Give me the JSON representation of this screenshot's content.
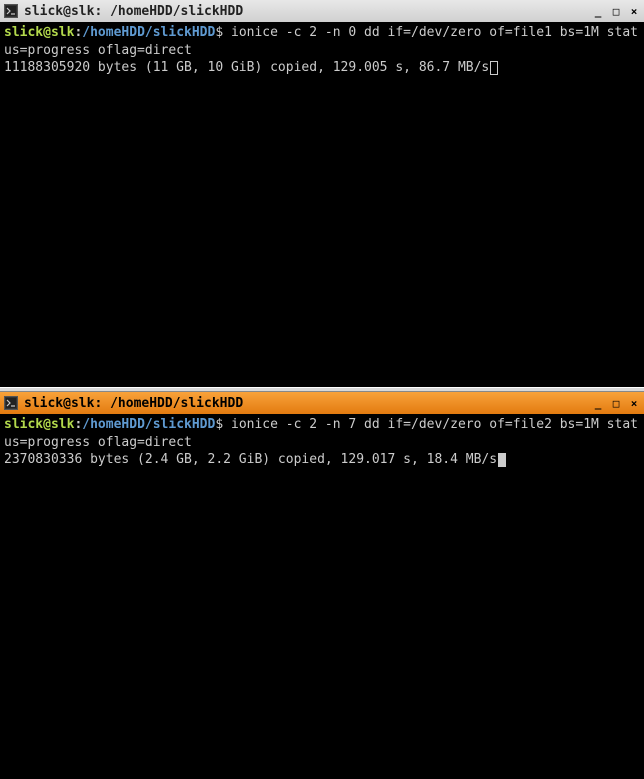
{
  "windows": [
    {
      "title": "slick@slk: /homeHDD/slickHDD",
      "active": false,
      "prompt": {
        "user_host": "slick@slk",
        "colon": ":",
        "path": "/homeHDD/slickHDD",
        "dollar": "$"
      },
      "command": " ionice -c 2 -n 0 dd if=/dev/zero of=file1 bs=1M status=progress oflag=direct",
      "output": "11188305920 bytes (11 GB, 10 GiB) copied, 129.005 s, 86.7 MB/s",
      "cursor": "outline"
    },
    {
      "title": "slick@slk: /homeHDD/slickHDD",
      "active": true,
      "prompt": {
        "user_host": "slick@slk",
        "colon": ":",
        "path": "/homeHDD/slickHDD",
        "dollar": "$"
      },
      "command": " ionice -c 2 -n 7 dd if=/dev/zero of=file2 bs=1M status=progress oflag=direct",
      "output": "2370830336 bytes (2.4 GB, 2.2 GiB) copied, 129.017 s, 18.4 MB/s",
      "cursor": "block"
    }
  ],
  "controls": {
    "minimize": "_",
    "maximize": "□",
    "close": "×"
  }
}
